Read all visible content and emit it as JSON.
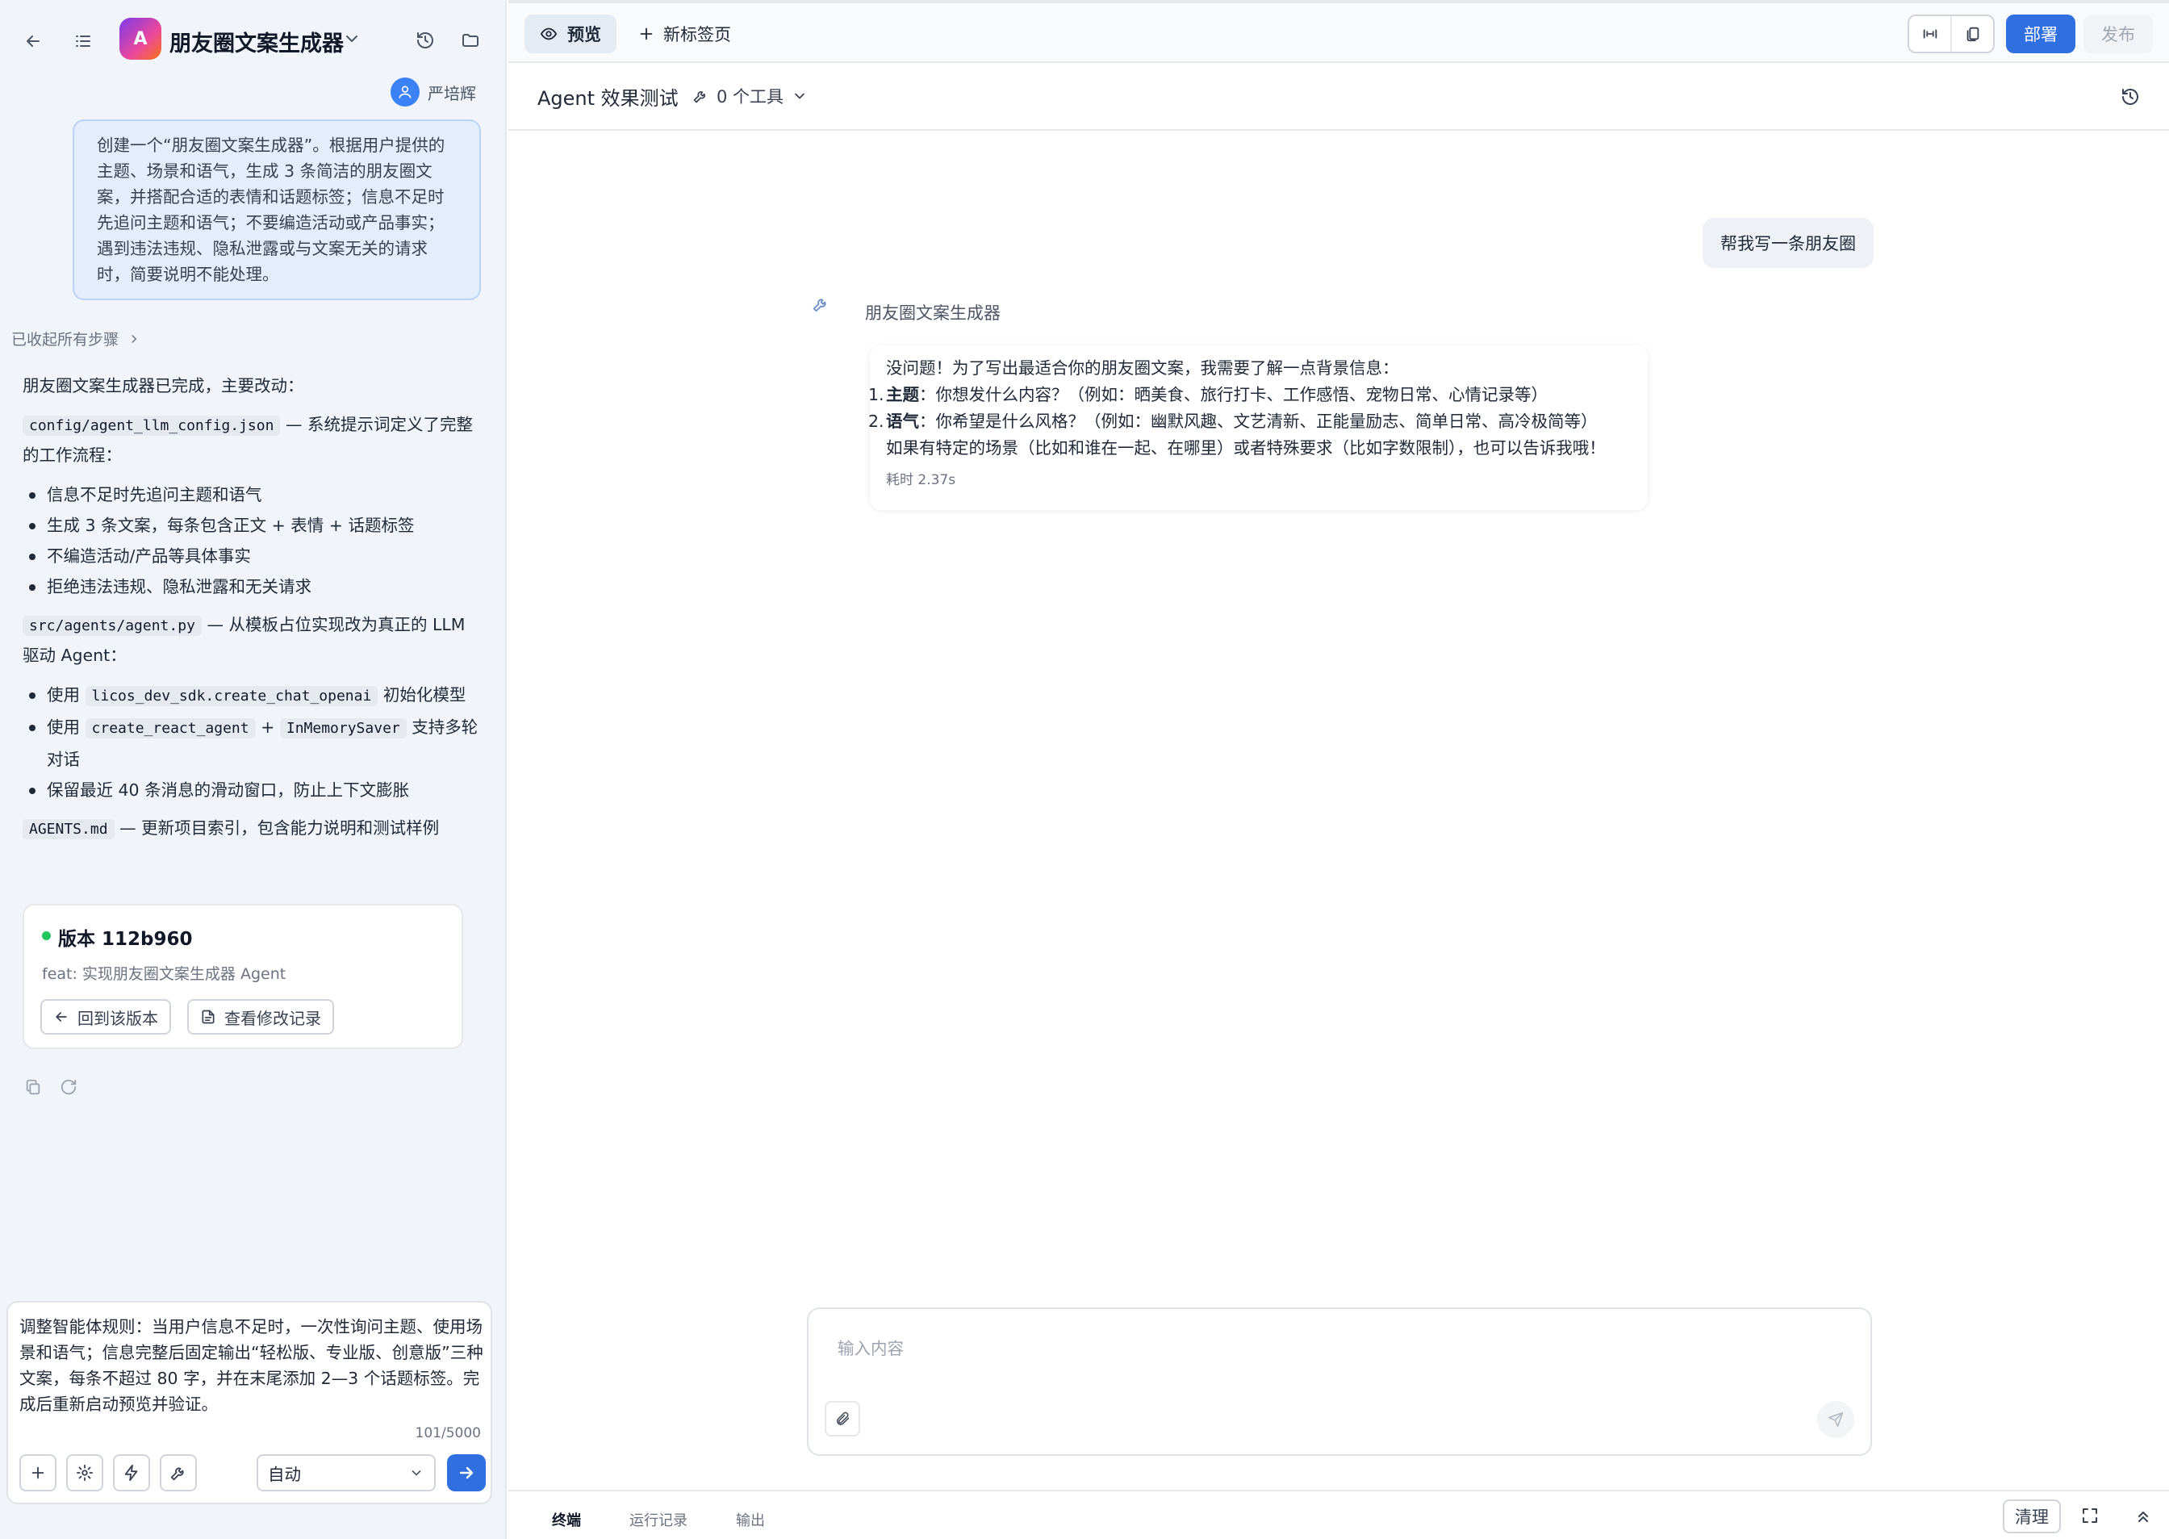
{
  "left": {
    "header": {
      "app_logo_letter": "A",
      "app_title": "朋友圈文案生成器"
    },
    "user_name": "严培辉",
    "user_message": "创建一个“朋友圈文案生成器”。根据用户提供的主题、场景和语气，生成 3 条简洁的朋友圈文案，并搭配合适的表情和话题标签；信息不足时先追问主题和语气；不要编造活动或产品事实；遇到违法违规、隐私泄露或与文案无关的请求时，简要说明不能处理。",
    "collapsed_steps": "已收起所有步骤",
    "assistant": {
      "intro": "朋友圈文案生成器已完成，主要改动：",
      "file1": "config/agent_llm_config.json",
      "file1_desc": "— 系统提示词定义了完整的工作流程：",
      "file1_items": [
        "信息不足时先追问主题和语气",
        "生成 3 条文案，每条包含正文 + 表情 + 话题标签",
        "不编造活动/产品等具体事实",
        "拒绝违法违规、隐私泄露和无关请求"
      ],
      "file2": "src/agents/agent.py",
      "file2_desc": "— 从模板占位实现改为真正的 LLM 驱动 Agent：",
      "file2_items": [
        {
          "pre": "使用",
          "code1": "licos_dev_sdk.create_chat_openai",
          "post": "初始化模型"
        },
        {
          "pre": "使用",
          "code1": "create_react_agent",
          "mid": "+",
          "code2": "InMemorySaver",
          "post": "支持多轮对话"
        },
        {
          "pre": "保留最近 40 条消息的滑动窗口，防止上下文膨胀"
        }
      ],
      "file3": "AGENTS.md",
      "file3_desc": "— 更新项目索引，包含能力说明和测试样例"
    },
    "version_card": {
      "title": "版本 112b960",
      "desc": "feat: 实现朋友圈文案生成器 Agent",
      "revert_label": "回到该版本",
      "history_label": "查看修改记录"
    },
    "composer": {
      "text": "调整智能体规则：当用户信息不足时，一次性询问主题、使用场景和语气；信息完整后固定输出“轻松版、专业版、创意版”三种文案，每条不超过 80 字，并在末尾添加 2—3 个话题标签。完成后重新启动预览并验证。",
      "char_count": "101/5000",
      "mode": "自动"
    }
  },
  "right": {
    "tabs": {
      "preview": "预览",
      "new_tab": "新标签页"
    },
    "deploy": "部署",
    "publish": "发布",
    "test_title": "Agent 效果测试",
    "tools": "0 个工具",
    "user_msg": "帮我写一条朋友圈",
    "bot_name": "朋友圈文案生成器",
    "bot_reply": {
      "line1": "没问题！为了写出最适合你的朋友圈文案，我需要了解一点背景信息：",
      "item1_label": "主题",
      "item1_text": "：你想发什么内容？（例如：晒美食、旅行打卡、工作感悟、宠物日常、心情记录等）",
      "item2_label": "语气",
      "item2_text": "：你希望是什么风格？（例如：幽默风趣、文艺清新、正能量励志、简单日常、高冷极简等）",
      "line_last": "如果有特定的场景（比如和谁在一起、在哪里）或者特殊要求（比如字数限制），也可以告诉我哦！",
      "time": "耗时 2.37s"
    },
    "input_placeholder": "输入内容",
    "bottom_tabs": {
      "terminal": "终端",
      "runs": "运行记录",
      "output": "输出"
    },
    "clear": "清理"
  },
  "colors": {
    "accent": "#2f6fe0",
    "version_dot": "#22c55e",
    "user_bubble": "#e3edfb"
  }
}
